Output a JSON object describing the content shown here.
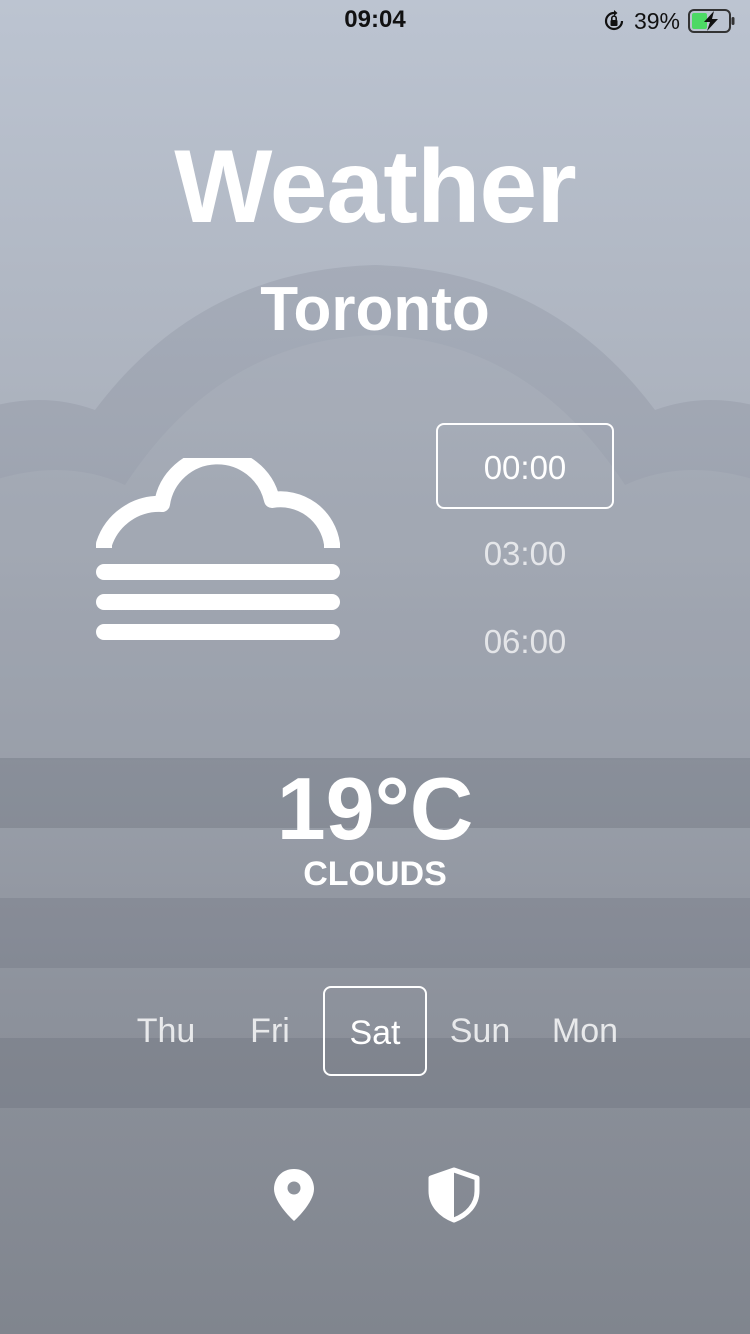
{
  "status_bar": {
    "time": "09:04",
    "battery": "39%",
    "icons": [
      "orientation-lock-icon",
      "battery-charging-icon"
    ]
  },
  "app": {
    "title": "Weather",
    "city": "Toronto"
  },
  "forecast": {
    "icon": "fog-icon",
    "times": [
      "00:00",
      "03:00",
      "06:00"
    ],
    "selected_time": "00:00",
    "temperature": "19°C",
    "condition": "CLOUDS"
  },
  "days": {
    "items": [
      "Thu",
      "Fri",
      "Sat",
      "Sun",
      "Mon"
    ],
    "selected": "Sat"
  },
  "nav": {
    "icons": [
      "location-pin-icon",
      "shield-icon"
    ]
  },
  "colors": {
    "text": "#ffffff",
    "background_top": "#bcc4d1",
    "background_bottom": "#80858e"
  }
}
